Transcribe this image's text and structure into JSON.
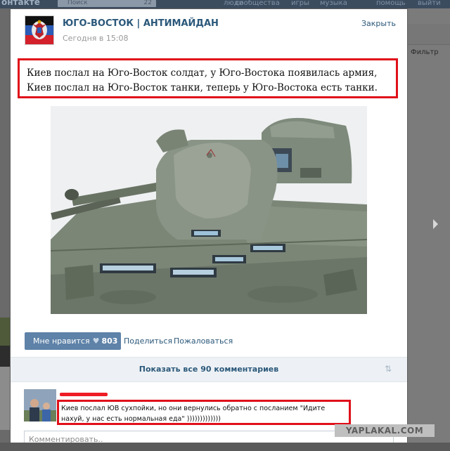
{
  "background": {
    "brand": "онтакте",
    "search_placeholder": "Поиск",
    "search_count": "22",
    "menu": [
      "люди",
      "сообщества",
      "игры",
      "музыка",
      "помощь",
      "выйти"
    ],
    "filter_label": "Фильтр"
  },
  "post": {
    "group_name": "ЮГО-ВОСТОК | АНТИМАЙДАН",
    "time": "Сегодня в 15:08",
    "close_label": "Закрыть",
    "text": "Киев послал на Юго-Восток солдат, у Юго-Востока появилась армия, Киев послал на Юго-Восток танки, теперь у Юго-Востока есть танки.",
    "like_label": "Мне нравится",
    "like_count": "803",
    "share_label": "Поделиться",
    "report_label": "Пожаловаться",
    "show_comments_label": "Показать все 90 комментариев",
    "sort_icon": "⇅"
  },
  "comment": {
    "text": "Киев послал ЮВ сухпойки, но они вернулись обратно с посланием \"Идите нахуй, у нас есть нормальная еда\" )))))))))))))"
  },
  "comment_input": {
    "placeholder": "Комментировать.."
  },
  "watermark": "YAPLAKAL.COM",
  "colors": {
    "link": "#2b587a",
    "like_button": "#5e82a8",
    "highlight": "#e0101a"
  }
}
